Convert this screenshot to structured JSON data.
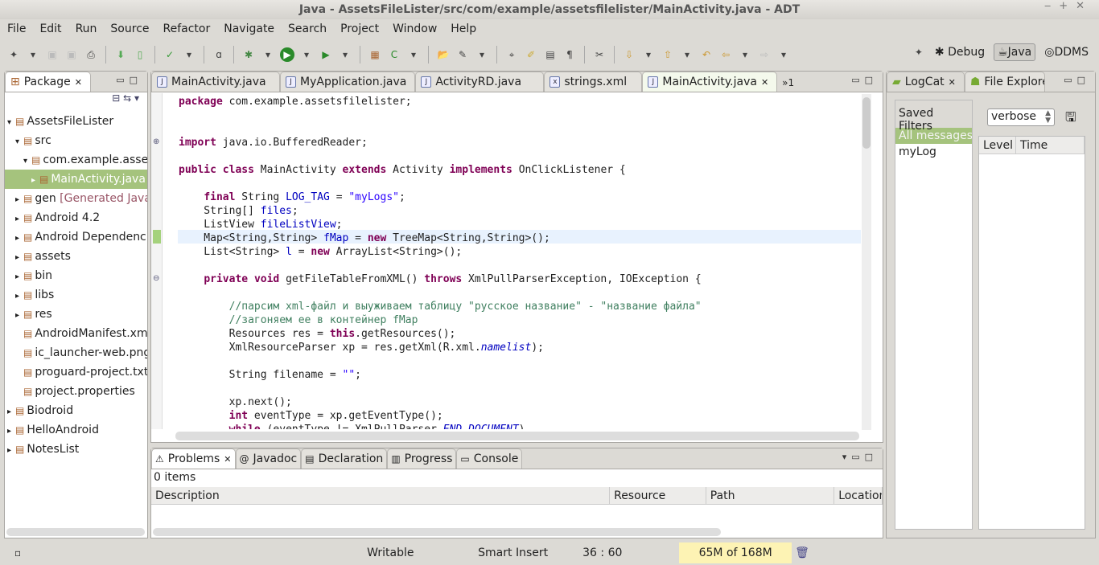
{
  "window": {
    "title": "Java - AssetsFileLister/src/com/example/assetsfilelister/MainActivity.java - ADT"
  },
  "menu": [
    "File",
    "Edit",
    "Run",
    "Source",
    "Refactor",
    "Navigate",
    "Search",
    "Project",
    "Window",
    "Help"
  ],
  "perspectives": {
    "debug": "Debug",
    "java": "Java",
    "ddms": "DDMS"
  },
  "package_explorer": {
    "tab": "Package",
    "items": [
      {
        "label": "AssetsFileLister",
        "indent": 0,
        "arrow": "▾"
      },
      {
        "label": "src",
        "indent": 1,
        "arrow": "▾"
      },
      {
        "label": "com.example.assetsfilelister",
        "indent": 2,
        "arrow": "▾"
      },
      {
        "label": "MainActivity.java",
        "indent": 3,
        "arrow": "▸",
        "selected": true
      },
      {
        "label": "gen",
        "extra": " [Generated Java Files]",
        "indent": 1,
        "arrow": "▸"
      },
      {
        "label": "Android 4.2",
        "indent": 1,
        "arrow": "▸"
      },
      {
        "label": "Android Dependencies",
        "indent": 1,
        "arrow": "▸"
      },
      {
        "label": "assets",
        "indent": 1,
        "arrow": "▸"
      },
      {
        "label": "bin",
        "indent": 1,
        "arrow": "▸"
      },
      {
        "label": "libs",
        "indent": 1,
        "arrow": "▸"
      },
      {
        "label": "res",
        "indent": 1,
        "arrow": "▸"
      },
      {
        "label": "AndroidManifest.xml",
        "indent": 1,
        "arrow": ""
      },
      {
        "label": "ic_launcher-web.png",
        "indent": 1,
        "arrow": ""
      },
      {
        "label": "proguard-project.txt",
        "indent": 1,
        "arrow": ""
      },
      {
        "label": "project.properties",
        "indent": 1,
        "arrow": ""
      },
      {
        "label": "Biodroid",
        "indent": 0,
        "arrow": "▸"
      },
      {
        "label": "HelloAndroid",
        "indent": 0,
        "arrow": "▸"
      },
      {
        "label": "NotesList",
        "indent": 0,
        "arrow": "▸"
      }
    ]
  },
  "editor": {
    "tabs": [
      {
        "label": "MainActivity.java",
        "icon": "J"
      },
      {
        "label": "MyApplication.java",
        "icon": "J"
      },
      {
        "label": "ActivityRD.java",
        "icon": "J"
      },
      {
        "label": "strings.xml",
        "icon": "x"
      },
      {
        "label": "MainActivity.java",
        "icon": "J",
        "active": true
      }
    ],
    "overflow": "»1",
    "lines": [
      [
        [
          "k",
          "package"
        ],
        [
          "t",
          " com.example.assetsfilelister;"
        ]
      ],
      [],
      [],
      [
        [
          "k",
          "import"
        ],
        [
          "t",
          " java.io.BufferedReader;"
        ]
      ],
      [],
      [
        [
          "k",
          "public"
        ],
        [
          "t",
          " "
        ],
        [
          "k",
          "class"
        ],
        [
          "t",
          " MainActivity "
        ],
        [
          "k",
          "extends"
        ],
        [
          "t",
          " Activity "
        ],
        [
          "k",
          "implements"
        ],
        [
          "t",
          " OnClickListener {"
        ]
      ],
      [],
      [
        [
          "t",
          "    "
        ],
        [
          "k",
          "final"
        ],
        [
          "t",
          " String "
        ],
        [
          "f",
          "LOG_TAG"
        ],
        [
          "t",
          " = "
        ],
        [
          "s",
          "\"myLogs\""
        ],
        [
          "t",
          ";"
        ]
      ],
      [
        [
          "t",
          "    String[] "
        ],
        [
          "f",
          "files"
        ],
        [
          "t",
          ";"
        ]
      ],
      [
        [
          "t",
          "    ListView "
        ],
        [
          "f",
          "fileListView"
        ],
        [
          "t",
          ";"
        ]
      ],
      [
        [
          "t",
          "    Map<String,String> "
        ],
        [
          "f",
          "fMap"
        ],
        [
          "t",
          " = "
        ],
        [
          "k",
          "new"
        ],
        [
          "t",
          " TreeMap<String,String>();"
        ]
      ],
      [
        [
          "t",
          "    List<String> "
        ],
        [
          "f",
          "l"
        ],
        [
          "t",
          " = "
        ],
        [
          "k",
          "new"
        ],
        [
          "t",
          " ArrayList<String>();"
        ]
      ],
      [],
      [
        [
          "t",
          "    "
        ],
        [
          "k",
          "private"
        ],
        [
          "t",
          " "
        ],
        [
          "k",
          "void"
        ],
        [
          "t",
          " getFileTableFromXML() "
        ],
        [
          "k",
          "throws"
        ],
        [
          "t",
          " XmlPullParserException, IOException {"
        ]
      ],
      [],
      [
        [
          "c",
          "        //парсим xml-файл и выуживаем таблицу \"русское название\" - \"название файла\""
        ]
      ],
      [
        [
          "c",
          "        //загоняем ее в контейнер fMap"
        ]
      ],
      [
        [
          "t",
          "        Resources res = "
        ],
        [
          "k",
          "this"
        ],
        [
          "t",
          ".getResources();"
        ]
      ],
      [
        [
          "t",
          "        XmlResourceParser xp = res.getXml(R.xml."
        ],
        [
          "i",
          "namelist"
        ],
        [
          "t",
          ");"
        ]
      ],
      [],
      [
        [
          "t",
          "        String filename = "
        ],
        [
          "s",
          "\"\""
        ],
        [
          "t",
          ";"
        ]
      ],
      [],
      [
        [
          "t",
          "        xp.next();"
        ]
      ],
      [
        [
          "t",
          "        "
        ],
        [
          "k",
          "int"
        ],
        [
          "t",
          " eventType = xp.getEventType();"
        ]
      ],
      [
        [
          "t",
          "        "
        ],
        [
          "k",
          "while"
        ],
        [
          "t",
          " (eventType != XmlPullParser."
        ],
        [
          "i",
          "END_DOCUMENT"
        ],
        [
          "t",
          ")"
        ]
      ]
    ]
  },
  "problems": {
    "tabs": [
      "Problems",
      "Javadoc",
      "Declaration",
      "Progress",
      "Console"
    ],
    "count": "0 items",
    "columns": [
      "Description",
      "Resource",
      "Path",
      "Location"
    ]
  },
  "logcat": {
    "tabs": [
      "LogCat",
      "File Explorer"
    ],
    "saved_filters": "Saved Filters",
    "filters": [
      "All messages (no filters)",
      "myLog"
    ],
    "level_select": "verbose",
    "columns": [
      "Level",
      "Time"
    ]
  },
  "status": {
    "writable": "Writable",
    "insert_mode": "Smart Insert",
    "position": "36 : 60",
    "memory": "65M of 168M"
  }
}
